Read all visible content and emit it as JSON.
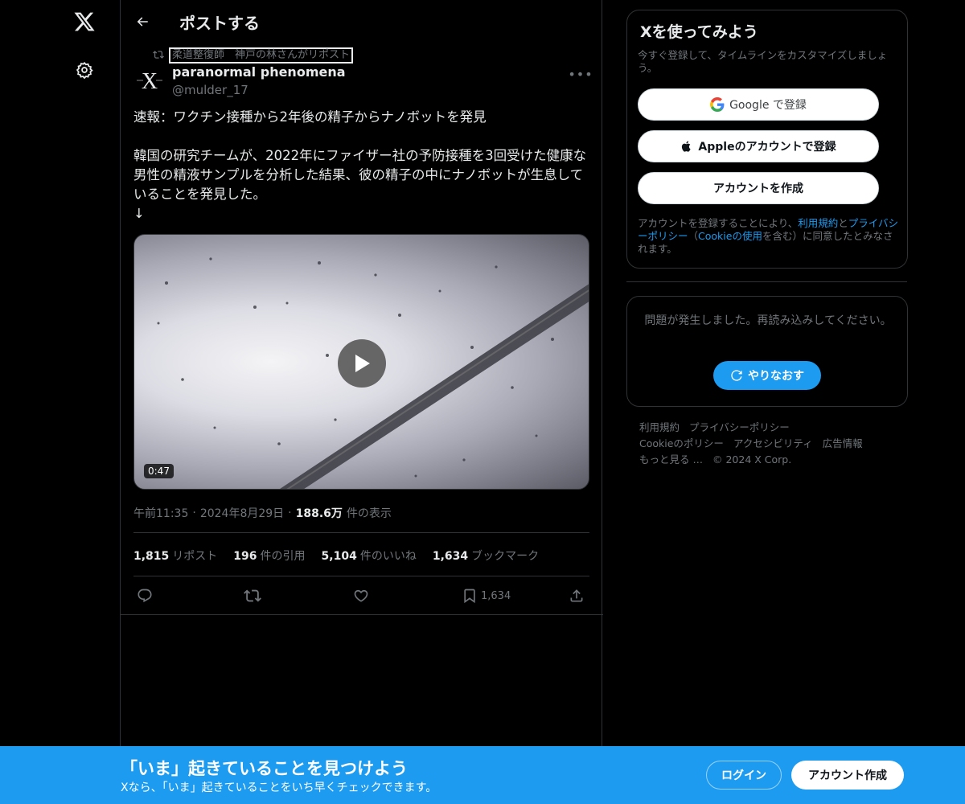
{
  "nav": {
    "logo_icon": "x-logo-icon",
    "settings_icon": "gear-icon"
  },
  "header": {
    "title": "ポストする"
  },
  "post": {
    "repost_by": "柔道整復師　神戸の林さんがリポスト",
    "author_name": "paranormal phenomena",
    "author_handle": "@mulder_17",
    "text": "速報：ワクチン接種から2年後の精子からナノボットを発見\n\n韓国の研究チームが、2022年にファイザー社の予防接種を3回受けた健康な男性の精液サンプルを分析した結果、彼の精子の中にナノボットが生息していることを発見した。\n↓",
    "video_duration": "0:47",
    "time": "午前11:35",
    "date": "2024年8月29日",
    "views_count": "188.6万",
    "views_label": "件の表示",
    "stats": {
      "reposts_count": "1,815",
      "reposts_label": "リポスト",
      "quotes_count": "196",
      "quotes_label": "件の引用",
      "likes_count": "5,104",
      "likes_label": "件のいいね",
      "bookmarks_count": "1,634",
      "bookmarks_label": "ブックマーク"
    },
    "action_bookmark_count": "1,634"
  },
  "signup": {
    "title": "Xを使ってみよう",
    "subtitle": "今すぐ登録して、タイムラインをカスタマイズしましょう。",
    "google_label": "Google で登録",
    "apple_label": "Appleのアカウントで登録",
    "create_label": "アカウントを作成",
    "legal_prefix": "アカウントを登録することにより、",
    "legal_terms": "利用規約",
    "legal_and": "と",
    "legal_privacy": "プライバシーポリシー",
    "legal_mid": "（",
    "legal_cookie": "Cookieの使用",
    "legal_suffix": "を含む）に同意したとみなされます。"
  },
  "error": {
    "message": "問題が発生しました。再読み込みしてください。",
    "retry_label": "やりなおす"
  },
  "footer": {
    "links": [
      "利用規約",
      "プライバシーポリシー",
      "Cookieのポリシー",
      "アクセシビリティ",
      "広告情報",
      "もっと見る …",
      "© 2024 X Corp."
    ]
  },
  "banner": {
    "title": "「いま」起きていることを見つけよう",
    "subtitle": "Xなら、「いま」起きていることをいち早くチェックできます。",
    "login_label": "ログイン",
    "create_label": "アカウント作成"
  },
  "colors": {
    "accent": "#1d9bf0",
    "background": "#000000",
    "border": "#2f3336",
    "muted": "#71767b"
  }
}
